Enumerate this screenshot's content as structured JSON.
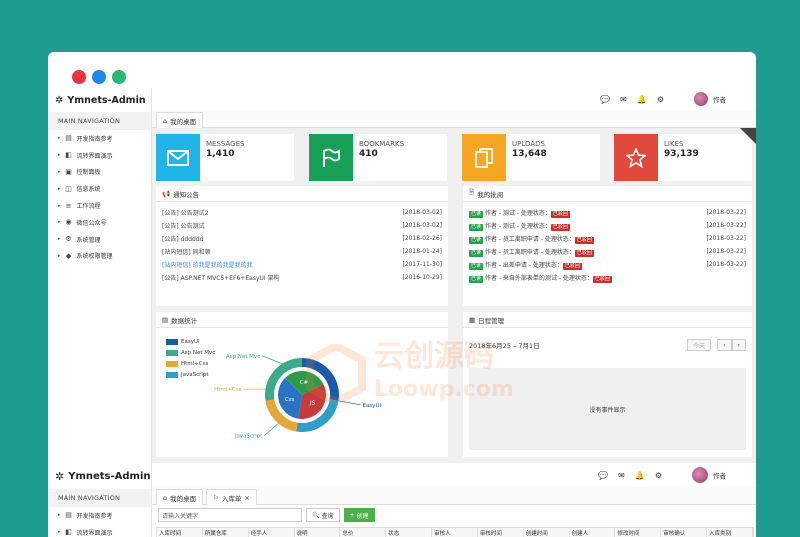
{
  "colors": {
    "background": "#1e9c8f",
    "blue": "#1fb5e8",
    "green": "#18a058",
    "orange": "#f5a623",
    "red": "#e04a3c"
  },
  "window_dots": [
    "#e8343f",
    "#1e88e5",
    "#2bb673"
  ],
  "app": {
    "name": "Ymnets-Admin",
    "nav_heading": "MAIN NAVIGATION"
  },
  "sidebar": {
    "items": [
      {
        "label": "开发指南参考",
        "icon": "book-icon"
      },
      {
        "label": "流转界面演示",
        "icon": "flow-icon"
      },
      {
        "label": "控制面板",
        "icon": "dashboard-icon"
      },
      {
        "label": "信息系统",
        "icon": "info-icon"
      },
      {
        "label": "工作流程",
        "icon": "workflow-icon"
      },
      {
        "label": "微信公众号",
        "icon": "wechat-icon"
      },
      {
        "label": "系统管理",
        "icon": "settings-icon"
      },
      {
        "label": "系统权限管理",
        "icon": "shield-icon"
      }
    ]
  },
  "header": {
    "user_name": "作者"
  },
  "tabs": {
    "home": "我的桌面"
  },
  "stats": [
    {
      "label": "MESSAGES",
      "value": "1,410"
    },
    {
      "label": "BOOKMARKS",
      "value": "410"
    },
    {
      "label": "UPLOADS",
      "value": "13,648"
    },
    {
      "label": "LIKES",
      "value": "93,139"
    }
  ],
  "notices": {
    "title": "通知公告",
    "items": [
      {
        "text": "[公告] 公告测试2",
        "date": "[2018-03-02]"
      },
      {
        "text": "[公告] 公告测试",
        "date": "[2018-03-02]"
      },
      {
        "text": "[公告] dddddd",
        "date": "[2018-02-26]"
      },
      {
        "text": "[站内短信] 同和顿",
        "date": "[2018-01-24]"
      },
      {
        "text": "[站内短信] 的我是我的我是我的我",
        "date": "[2017-11-30]"
      },
      {
        "text": "[公告] ASP.NET MVC5+EF6+EasyUI 架构",
        "date": "[2016-10-29]"
      }
    ]
  },
  "approvals": {
    "title": "我的批阅",
    "items": [
      {
        "tag": "已读",
        "text": "作者 - 测试 - 处理状态：",
        "status": "已驳回",
        "date": "[2018-03-22]"
      },
      {
        "tag": "已读",
        "text": "作者 - 测试 - 处理状态：",
        "status": "已驳回",
        "date": "[2018-03-22]"
      },
      {
        "tag": "已读",
        "text": "作者 - 员工离职申请 - 处理状态：",
        "status": "已驳回",
        "date": "[2018-03-22]"
      },
      {
        "tag": "已读",
        "text": "作者 - 员工离职申请 - 处理状态：",
        "status": "已驳回",
        "date": "[2018-03-22]"
      },
      {
        "tag": "已读",
        "text": "作者 - 出差申请 - 处理状态：",
        "status": "已驳回",
        "date": "[2018-03-22]"
      },
      {
        "tag": "已读",
        "text": "作者 - 来自外部表单的测试 - 处理状态：",
        "status": "已驳回",
        "date": ""
      }
    ]
  },
  "chart_panel": {
    "title": "数据统计"
  },
  "chart_data": {
    "type": "pie",
    "series": [
      {
        "name": "EasyUI",
        "color": "#1a5aa8"
      },
      {
        "name": "Asp.Net Mvc",
        "color": "#3daa8c"
      },
      {
        "name": "Html+Css",
        "color": "#e0a93a"
      },
      {
        "name": "JavaScript",
        "color": "#2f9ec8"
      }
    ],
    "inner": [
      {
        "name": "C#",
        "color": "#2e9a4a",
        "value": 30
      },
      {
        "name": "JS",
        "color": "#c63b3b",
        "value": 35
      },
      {
        "name": "Css",
        "color": "#2a73c4",
        "value": 35
      }
    ],
    "outer_labels": [
      "Asp.Net Mvc",
      "Html+Css",
      "JavaScript",
      "EasyUI"
    ]
  },
  "calendar": {
    "title": "日程管理",
    "range": "2018年6月25 – 7月1日",
    "today": "今天",
    "prev": "‹",
    "next": "›",
    "empty": "没有事件显示"
  },
  "bottom": {
    "tab_home": "我的桌面",
    "tab_current": "入库单",
    "search_placeholder": "请输入关键字",
    "query": "查询",
    "create": "创建",
    "columns": [
      "入库时间",
      "所属仓库",
      "经手人",
      "说明",
      "总价",
      "状态",
      "审核人",
      "审核时间",
      "创建时间",
      "创建人",
      "修改时间",
      "审核确认",
      "入库类别"
    ]
  }
}
